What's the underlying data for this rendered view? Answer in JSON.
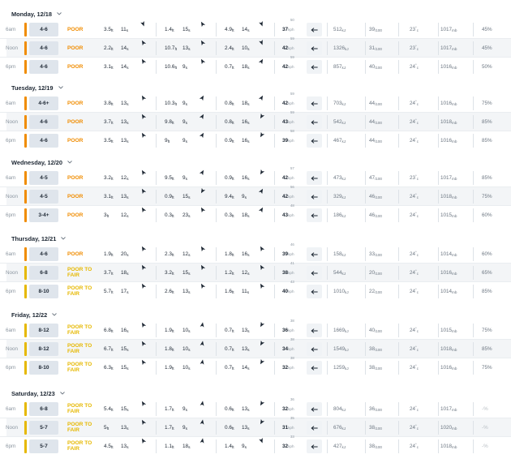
{
  "units": {
    "height": "ft",
    "period": "s",
    "wind": "kph",
    "energy": "kJ",
    "consistency_max": "/100",
    "pressure": "mb",
    "temp_unit": "c"
  },
  "colors": {
    "poor": "#f08c00",
    "poor_to_fair": "#e6b800",
    "bar_poor": "#f08c00",
    "bar_fair": "#e6b800"
  },
  "days": [
    {
      "label": "Monday, 12/18",
      "rows": [
        {
          "time": "6am",
          "size": "4-6",
          "rating": "POOR",
          "s1h": "3.5",
          "s1p": "11",
          "s1dir": 160,
          "s2h": "1.4",
          "s2p": "15",
          "s2dir": 330,
          "s3h": "4.9",
          "s3p": "14",
          "s3dir": 160,
          "wind": "37",
          "gust": "50",
          "winddir": 0,
          "energy": "512",
          "consistency": "39",
          "temp": "23",
          "pressure": "1017",
          "humidity": "45%"
        },
        {
          "time": "Noon",
          "size": "4-6",
          "rating": "POOR",
          "s1h": "2.2",
          "s1p": "14",
          "s1dir": 330,
          "s2h": "10.7",
          "s2p": "13",
          "s2dir": 330,
          "s3h": "2.4",
          "s3p": "10",
          "s3dir": 160,
          "wind": "42",
          "gust": "59",
          "winddir": 0,
          "energy": "1326",
          "consistency": "31",
          "temp": "23",
          "pressure": "1017",
          "humidity": "45%"
        },
        {
          "time": "6pm",
          "size": "4-6",
          "rating": "POOR",
          "s1h": "3.1",
          "s1p": "14",
          "s1dir": 330,
          "s2h": "10.6",
          "s2p": "9",
          "s2dir": 330,
          "s3h": "0.7",
          "s3p": "18",
          "s3dir": 30,
          "wind": "42",
          "gust": "59",
          "winddir": 0,
          "energy": "857",
          "consistency": "40",
          "temp": "24",
          "pressure": "1016",
          "humidity": "50%"
        }
      ]
    },
    {
      "label": "Tuesday, 12/19",
      "rows": [
        {
          "time": "6am",
          "size": "4-6+",
          "rating": "POOR",
          "s1h": "3.8",
          "s1p": "13",
          "s1dir": 330,
          "s2h": "10.3",
          "s2p": "9",
          "s2dir": 30,
          "s3h": "0.8",
          "s3p": "18",
          "s3dir": 30,
          "wind": "42",
          "gust": "59",
          "winddir": 0,
          "energy": "703",
          "consistency": "44",
          "temp": "24",
          "pressure": "1016",
          "humidity": "75%"
        },
        {
          "time": "Noon",
          "size": "4-6",
          "rating": "POOR",
          "s1h": "3.7",
          "s1p": "13",
          "s1dir": 330,
          "s2h": "9.8",
          "s2p": "9",
          "s2dir": 30,
          "s3h": "0.8",
          "s3p": "16",
          "s3dir": 210,
          "wind": "43",
          "gust": "59",
          "winddir": 0,
          "energy": "542",
          "consistency": "44",
          "temp": "24",
          "pressure": "1018",
          "humidity": "85%"
        },
        {
          "time": "6pm",
          "size": "4-6",
          "rating": "POOR",
          "s1h": "3.5",
          "s1p": "13",
          "s1dir": 330,
          "s2h": "9",
          "s2p": "9",
          "s2dir": 30,
          "s3h": "0.9",
          "s3p": "16",
          "s3dir": 210,
          "wind": "39",
          "gust": "58",
          "winddir": 0,
          "energy": "467",
          "consistency": "44",
          "temp": "24",
          "pressure": "1016",
          "humidity": "85%"
        }
      ]
    },
    {
      "label": "Wednesday, 12/20",
      "rows": [
        {
          "time": "6am",
          "size": "4-5",
          "rating": "POOR",
          "s1h": "3.2",
          "s1p": "12",
          "s1dir": 330,
          "s2h": "9.5",
          "s2p": "9",
          "s2dir": 30,
          "s3h": "0.9",
          "s3p": "16",
          "s3dir": 210,
          "wind": "42",
          "gust": "57",
          "winddir": 0,
          "energy": "473",
          "consistency": "47",
          "temp": "23",
          "pressure": "1017",
          "humidity": "85%"
        },
        {
          "time": "Noon",
          "size": "4-5",
          "rating": "POOR",
          "s1h": "3.1",
          "s1p": "13",
          "s1dir": 330,
          "s2h": "0.9",
          "s2p": "15",
          "s2dir": 210,
          "s3h": "9.4",
          "s3p": "9",
          "s3dir": 30,
          "wind": "42",
          "gust": "56",
          "winddir": 0,
          "energy": "329",
          "consistency": "46",
          "temp": "24",
          "pressure": "1018",
          "humidity": "75%"
        },
        {
          "time": "6pm",
          "size": "3-4+",
          "rating": "POOR",
          "s1h": "3",
          "s1p": "12",
          "s1dir": 330,
          "s2h": "0.3",
          "s2p": "23",
          "s2dir": 330,
          "s3h": "0.3",
          "s3p": "18",
          "s3dir": 30,
          "wind": "43",
          "gust": "48",
          "winddir": 0,
          "energy": "186",
          "consistency": "46",
          "temp": "24",
          "pressure": "1015",
          "humidity": "60%"
        }
      ]
    },
    {
      "label": "Thursday, 12/21",
      "rows": [
        {
          "time": "6am",
          "size": "4-6",
          "rating": "POOR",
          "s1h": "1.9",
          "s1p": "20",
          "s1dir": 330,
          "s2h": "2.3",
          "s2p": "12",
          "s2dir": 330,
          "s3h": "1.8",
          "s3p": "16",
          "s3dir": 330,
          "wind": "39",
          "gust": "46",
          "winddir": 0,
          "energy": "158",
          "consistency": "33",
          "temp": "24",
          "pressure": "1014",
          "humidity": "60%"
        },
        {
          "time": "Noon",
          "size": "6-8",
          "rating": "POOR TO FAIR",
          "s1h": "3.7",
          "s1p": "18",
          "s1dir": 330,
          "s2h": "3.2",
          "s2p": "15",
          "s2dir": 330,
          "s3h": "1.2",
          "s3p": "12",
          "s3dir": 330,
          "wind": "38",
          "gust": "41",
          "winddir": 0,
          "energy": "544",
          "consistency": "20",
          "temp": "24",
          "pressure": "1016",
          "humidity": "65%"
        },
        {
          "time": "6pm",
          "size": "8-10",
          "rating": "POOR TO FAIR",
          "s1h": "5.7",
          "s1p": "17",
          "s1dir": 330,
          "s2h": "2.6",
          "s2p": "13",
          "s2dir": 330,
          "s3h": "1.6",
          "s3p": "11",
          "s3dir": 330,
          "wind": "40",
          "gust": "43",
          "winddir": 0,
          "energy": "1010",
          "consistency": "22",
          "temp": "24",
          "pressure": "1014",
          "humidity": "85%"
        }
      ]
    },
    {
      "label": "Friday, 12/22",
      "rows": [
        {
          "time": "6am",
          "size": "8-12",
          "rating": "POOR TO FAIR",
          "s1h": "6.8",
          "s1p": "16",
          "s1dir": 330,
          "s2h": "1.9",
          "s2p": "10",
          "s2dir": 10,
          "s3h": "0.7",
          "s3p": "13",
          "s3dir": 210,
          "wind": "36",
          "gust": "38",
          "winddir": 0,
          "energy": "1669",
          "consistency": "40",
          "temp": "24",
          "pressure": "1015",
          "humidity": "75%"
        },
        {
          "time": "Noon",
          "size": "8-12",
          "rating": "POOR TO FAIR",
          "s1h": "6.7",
          "s1p": "15",
          "s1dir": 330,
          "s2h": "1.8",
          "s2p": "10",
          "s2dir": 10,
          "s3h": "0.7",
          "s3p": "13",
          "s3dir": 210,
          "wind": "34",
          "gust": "38",
          "winddir": 0,
          "energy": "1549",
          "consistency": "38",
          "temp": "24",
          "pressure": "1018",
          "humidity": "85%"
        },
        {
          "time": "6pm",
          "size": "8-10",
          "rating": "POOR TO FAIR",
          "s1h": "6.3",
          "s1p": "15",
          "s1dir": 330,
          "s2h": "1.9",
          "s2p": "10",
          "s2dir": 10,
          "s3h": "0.7",
          "s3p": "14",
          "s3dir": 210,
          "wind": "32",
          "gust": "38",
          "winddir": 0,
          "energy": "1259",
          "consistency": "38",
          "temp": "24",
          "pressure": "1016",
          "humidity": "75%"
        }
      ]
    },
    {
      "label": "Saturday, 12/23",
      "rows": [
        {
          "time": "6am",
          "size": "6-8",
          "rating": "POOR TO FAIR",
          "s1h": "5.4",
          "s1p": "15",
          "s1dir": 330,
          "s2h": "1.7",
          "s2p": "9",
          "s2dir": 10,
          "s3h": "0.6",
          "s3p": "13",
          "s3dir": 210,
          "wind": "32",
          "gust": "36",
          "winddir": 0,
          "energy": "804",
          "consistency": "36",
          "temp": "24",
          "pressure": "1017",
          "humidity": "-%"
        },
        {
          "time": "Noon",
          "size": "5-7",
          "rating": "POOR TO FAIR",
          "s1h": "5",
          "s1p": "13",
          "s1dir": 330,
          "s2h": "1.7",
          "s2p": "9",
          "s2dir": 10,
          "s3h": "0.6",
          "s3p": "13",
          "s3dir": 210,
          "wind": "31",
          "gust": "35",
          "winddir": 0,
          "energy": "676",
          "consistency": "38",
          "temp": "24",
          "pressure": "1020",
          "humidity": "-%"
        },
        {
          "time": "6pm",
          "size": "5-7",
          "rating": "POOR TO FAIR",
          "s1h": "4.5",
          "s1p": "13",
          "s1dir": 330,
          "s2h": "1.1",
          "s2p": "18",
          "s2dir": 10,
          "s3h": "1.4",
          "s3p": "9",
          "s3dir": 160,
          "wind": "32",
          "gust": "33",
          "winddir": 0,
          "energy": "427",
          "consistency": "38",
          "temp": "24",
          "pressure": "1018",
          "humidity": "-%"
        }
      ]
    }
  ]
}
